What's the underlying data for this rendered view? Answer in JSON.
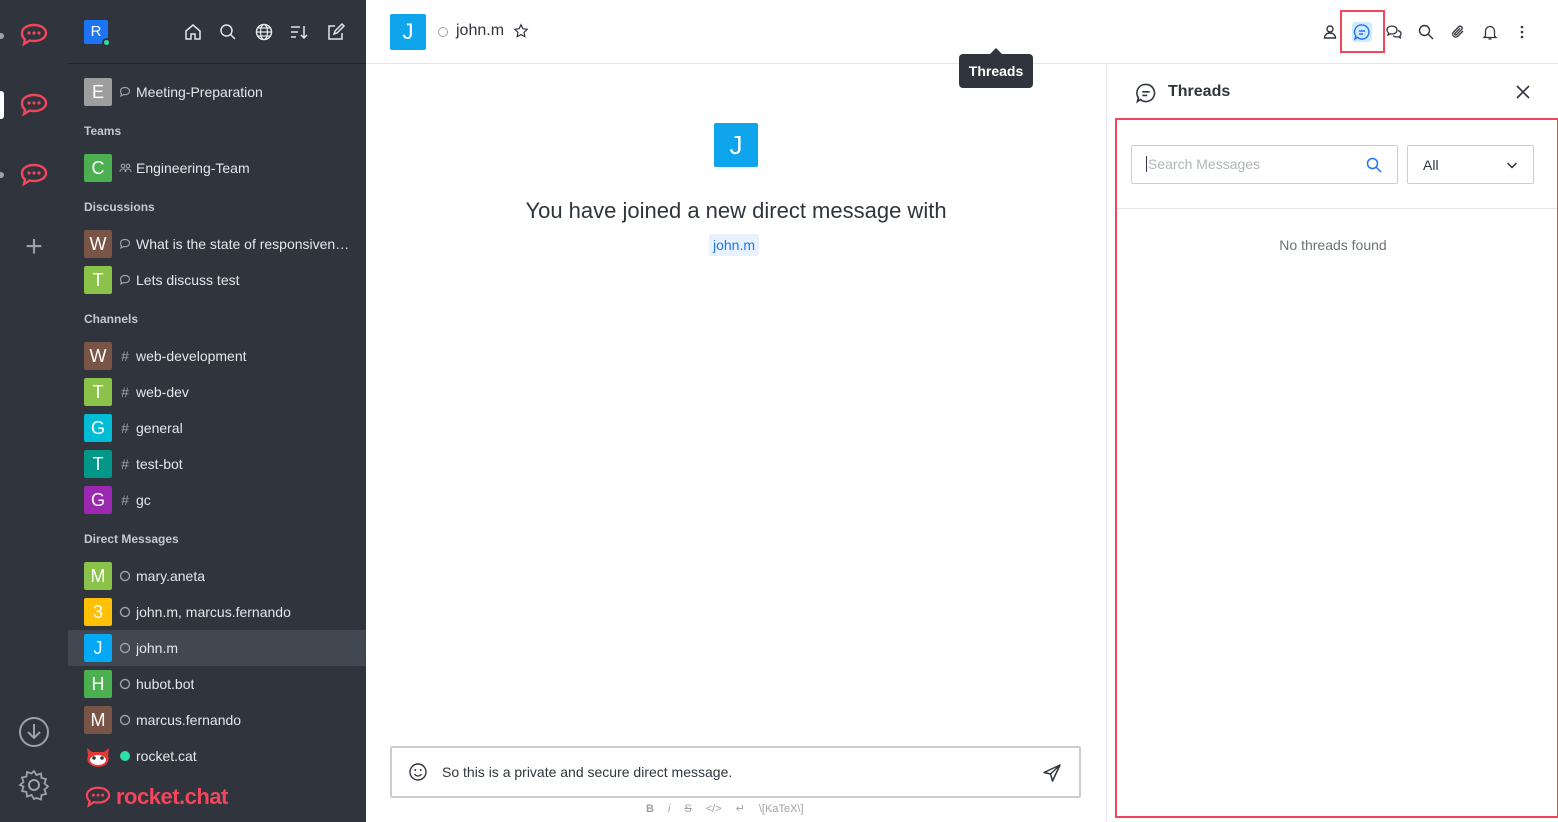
{
  "sidebar": {
    "user_avatar": "R",
    "sections": {
      "teams": "Teams",
      "discussions": "Discussions",
      "channels": "Channels",
      "direct_messages": "Direct Messages"
    },
    "items": [
      {
        "avatar": "E",
        "color": "#9e9e9e",
        "glyph": "discussion-icon",
        "name": "Meeting-Preparation"
      },
      {
        "avatar": "C",
        "color": "#4caf50",
        "glyph": "team-icon",
        "name": "Engineering-Team"
      },
      {
        "avatar": "W",
        "color": "#795548",
        "glyph": "discussion-icon",
        "name": "What is the state of responsiveness?"
      },
      {
        "avatar": "T",
        "color": "#8bc34a",
        "glyph": "discussion-icon",
        "name": "Lets discuss test"
      },
      {
        "avatar": "W",
        "color": "#795548",
        "glyph": "hash-icon",
        "name": "web-development"
      },
      {
        "avatar": "T",
        "color": "#8bc34a",
        "glyph": "hash-icon",
        "name": "web-dev"
      },
      {
        "avatar": "G",
        "color": "#00bcd4",
        "glyph": "hash-icon",
        "name": "general"
      },
      {
        "avatar": "T",
        "color": "#009688",
        "glyph": "hash-icon",
        "name": "test-bot"
      },
      {
        "avatar": "G",
        "color": "#9c27b0",
        "glyph": "hash-icon",
        "name": "gc"
      },
      {
        "avatar": "M",
        "color": "#8bc34a",
        "glyph": "status-offline-icon",
        "name": "mary.aneta"
      },
      {
        "avatar": "3",
        "color": "#ffc107",
        "glyph": "group-dm-icon",
        "name": "john.m, marcus.fernando"
      },
      {
        "avatar": "J",
        "color": "#03a9f4",
        "glyph": "status-offline-icon",
        "name": "john.m"
      },
      {
        "avatar": "H",
        "color": "#4caf50",
        "glyph": "status-offline-icon",
        "name": "hubot.bot"
      },
      {
        "avatar": "M",
        "color": "#795548",
        "glyph": "status-offline-icon",
        "name": "marcus.fernando"
      },
      {
        "avatar": "",
        "color": "#2f343d",
        "glyph": "status-online-icon",
        "name": "rocket.cat"
      }
    ],
    "brand": "rocket.chat"
  },
  "room": {
    "avatar": "J",
    "name": "john.m",
    "tooltip": "Threads"
  },
  "main": {
    "welcome_avatar": "J",
    "welcome_text": "You have joined a new direct message with",
    "mention": "john.m",
    "composer_text": "So this is a private and secure direct message.",
    "format_labels": [
      "B",
      "i",
      "S",
      "</>",
      "↵",
      "\\[KaTeX\\]"
    ]
  },
  "threads": {
    "title": "Threads",
    "search_placeholder": "Search Messages",
    "filter_value": "All",
    "empty_text": "No threads found"
  },
  "colors": {
    "accent": "#1d74f5",
    "brand": "#f5455c",
    "sidebar_bg": "#2f343d",
    "highlight": "#f5455c"
  }
}
